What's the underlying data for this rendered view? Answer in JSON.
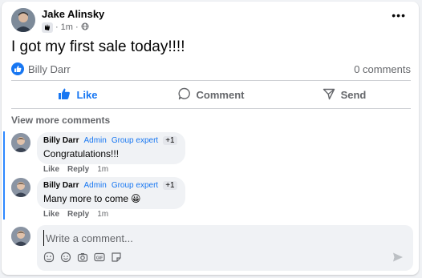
{
  "post": {
    "author": "Jake Alinsky",
    "time": "1m",
    "text": "I got my first sale today!!!!",
    "reactor": "Billy Darr",
    "comment_count": "0 comments"
  },
  "actions": {
    "like": "Like",
    "comment": "Comment",
    "send": "Send"
  },
  "view_more": "View more comments",
  "comments": [
    {
      "author": "Billy Darr",
      "tags": [
        "Admin",
        "Group expert"
      ],
      "extra": "+1",
      "text": "Congratulations!!!",
      "emoji": "",
      "like": "Like",
      "reply": "Reply",
      "time": "1m"
    },
    {
      "author": "Billy Darr",
      "tags": [
        "Admin",
        "Group expert"
      ],
      "extra": "+1",
      "text": "Many more to come",
      "emoji": "😀",
      "like": "Like",
      "reply": "Reply",
      "time": "1m"
    }
  ],
  "composer": {
    "placeholder": "Write a comment..."
  },
  "colors": {
    "accent": "#1877f2",
    "thread": "#2d88ff",
    "muted": "#65676b"
  },
  "icons": [
    "wave-badge-icon",
    "globe-icon",
    "more-icon",
    "like-reaction-icon",
    "thumbs-up-icon",
    "comment-icon",
    "send-icon",
    "sticker-icon",
    "emoji-icon",
    "camera-icon",
    "gif-icon",
    "avatar-sticker-icon",
    "send-arrow-icon"
  ]
}
